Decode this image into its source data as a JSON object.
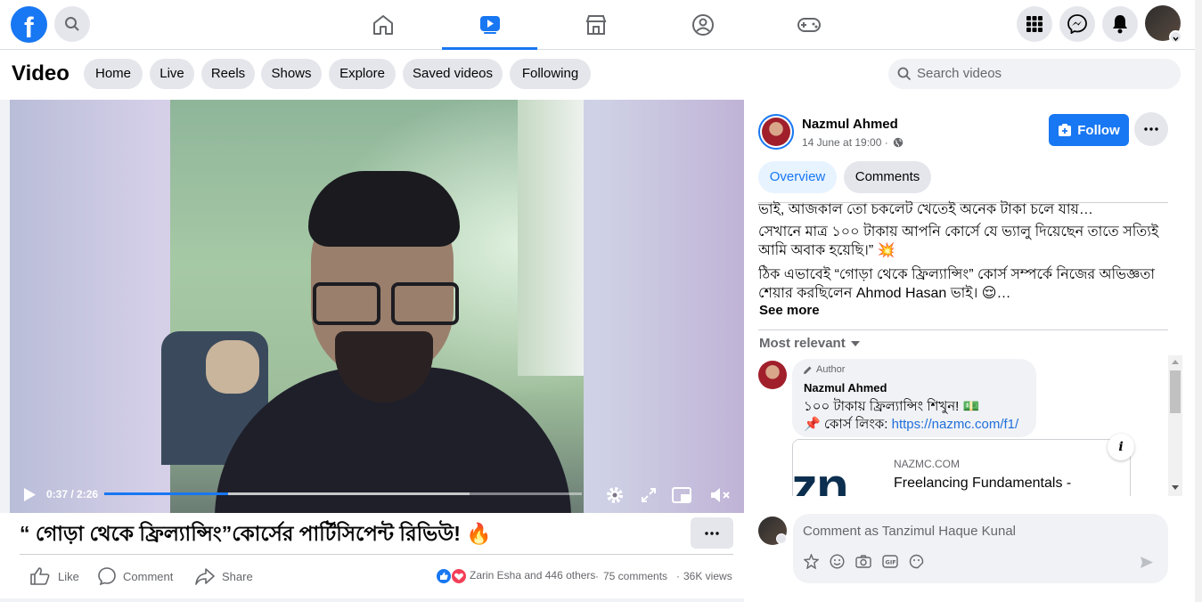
{
  "header": {
    "search_icon": "search-icon",
    "nav_tabs": [
      "home-icon",
      "watch-icon",
      "marketplace-icon",
      "groups-icon",
      "gaming-icon"
    ],
    "right_icons": [
      "menu-icon",
      "messenger-icon",
      "bell-icon"
    ]
  },
  "video_bar": {
    "title": "Video",
    "pills": [
      "Home",
      "Live",
      "Reels",
      "Shows",
      "Explore",
      "Saved videos",
      "Following"
    ],
    "search_placeholder": "Search videos"
  },
  "player": {
    "time": "0:37 / 2:26",
    "progress": 0.26
  },
  "post": {
    "title": "“ গোড়া থেকে ফ্রিল্যান্সিং”কোর্সের পার্টিসিপেন্ট রিভিউ! 🔥",
    "like_label": "Like",
    "comment_label": "Comment",
    "share_label": "Share",
    "reactions_text": "Zarin Esha and 446 others",
    "comments_count": "75 comments",
    "views": "36K views"
  },
  "author": {
    "name": "Nazmul Ahmed",
    "date": "14 June at 19:00 ·",
    "follow_label": "Follow"
  },
  "tabs": {
    "overview": "Overview",
    "comments": "Comments"
  },
  "description": {
    "line1": "ভাই, আজকাল তো চকলেট খেতেই অনেক টাকা চলে যায়…",
    "line2": "সেখানে মাত্র ১০০ টাকায় আপনি কোর্সে যে ভ্যালু দিয়েছেন তাতে সত্যিই আমি অবাক হয়েছি।” 💥",
    "line3": "ঠিক এভাবেই “গোড়া থেকে ফ্রিল্যান্সিং” কোর্স সম্পর্কে নিজের অভিজ্ঞতা শেয়ার করছিলেন Ahmod Hasan ভাই। 😌…",
    "see_more": "See more"
  },
  "comments_section": {
    "sort_label": "Most relevant",
    "comment": {
      "badge": "Author",
      "name": "Nazmul Ahmed",
      "text1": "১০০ টাকায় ফ্রিল্যান্সিং শিখুন! 💵",
      "text2_prefix": "📌 কোর্স লিংক: ",
      "link": "https://nazmc.com/f1/"
    },
    "link_preview": {
      "domain": "NAZMC.COM",
      "title": "Freelancing Fundamentals -",
      "logo_text": "zn"
    },
    "input_placeholder": "Comment as Tanzimul Haque Kunal"
  },
  "colors": {
    "brand": "#1877f2",
    "link": "#216fdb"
  }
}
